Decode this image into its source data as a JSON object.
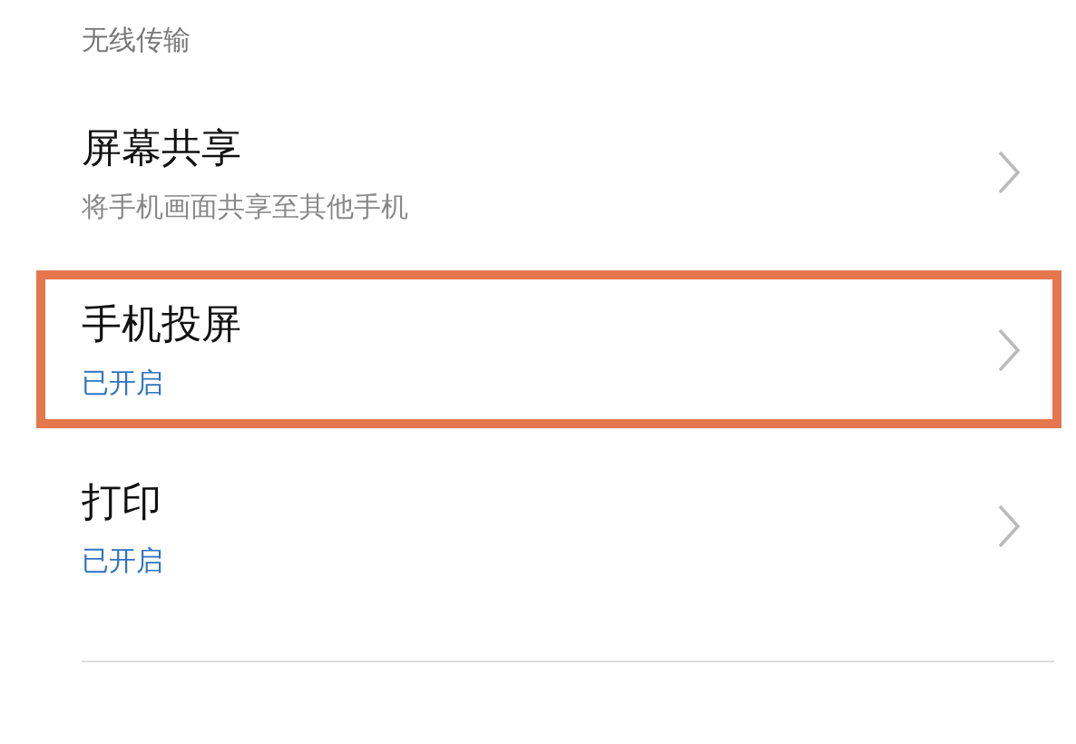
{
  "section": {
    "title": "无线传输"
  },
  "items": [
    {
      "title": "屏幕共享",
      "subtitle": {
        "text": "将手机画面共享至其他手机",
        "kind": "description"
      },
      "highlighted": false
    },
    {
      "title": "手机投屏",
      "subtitle": {
        "text": "已开启",
        "kind": "status"
      },
      "highlighted": true
    },
    {
      "title": "打印",
      "subtitle": {
        "text": "已开启",
        "kind": "status"
      },
      "highlighted": false
    }
  ]
}
